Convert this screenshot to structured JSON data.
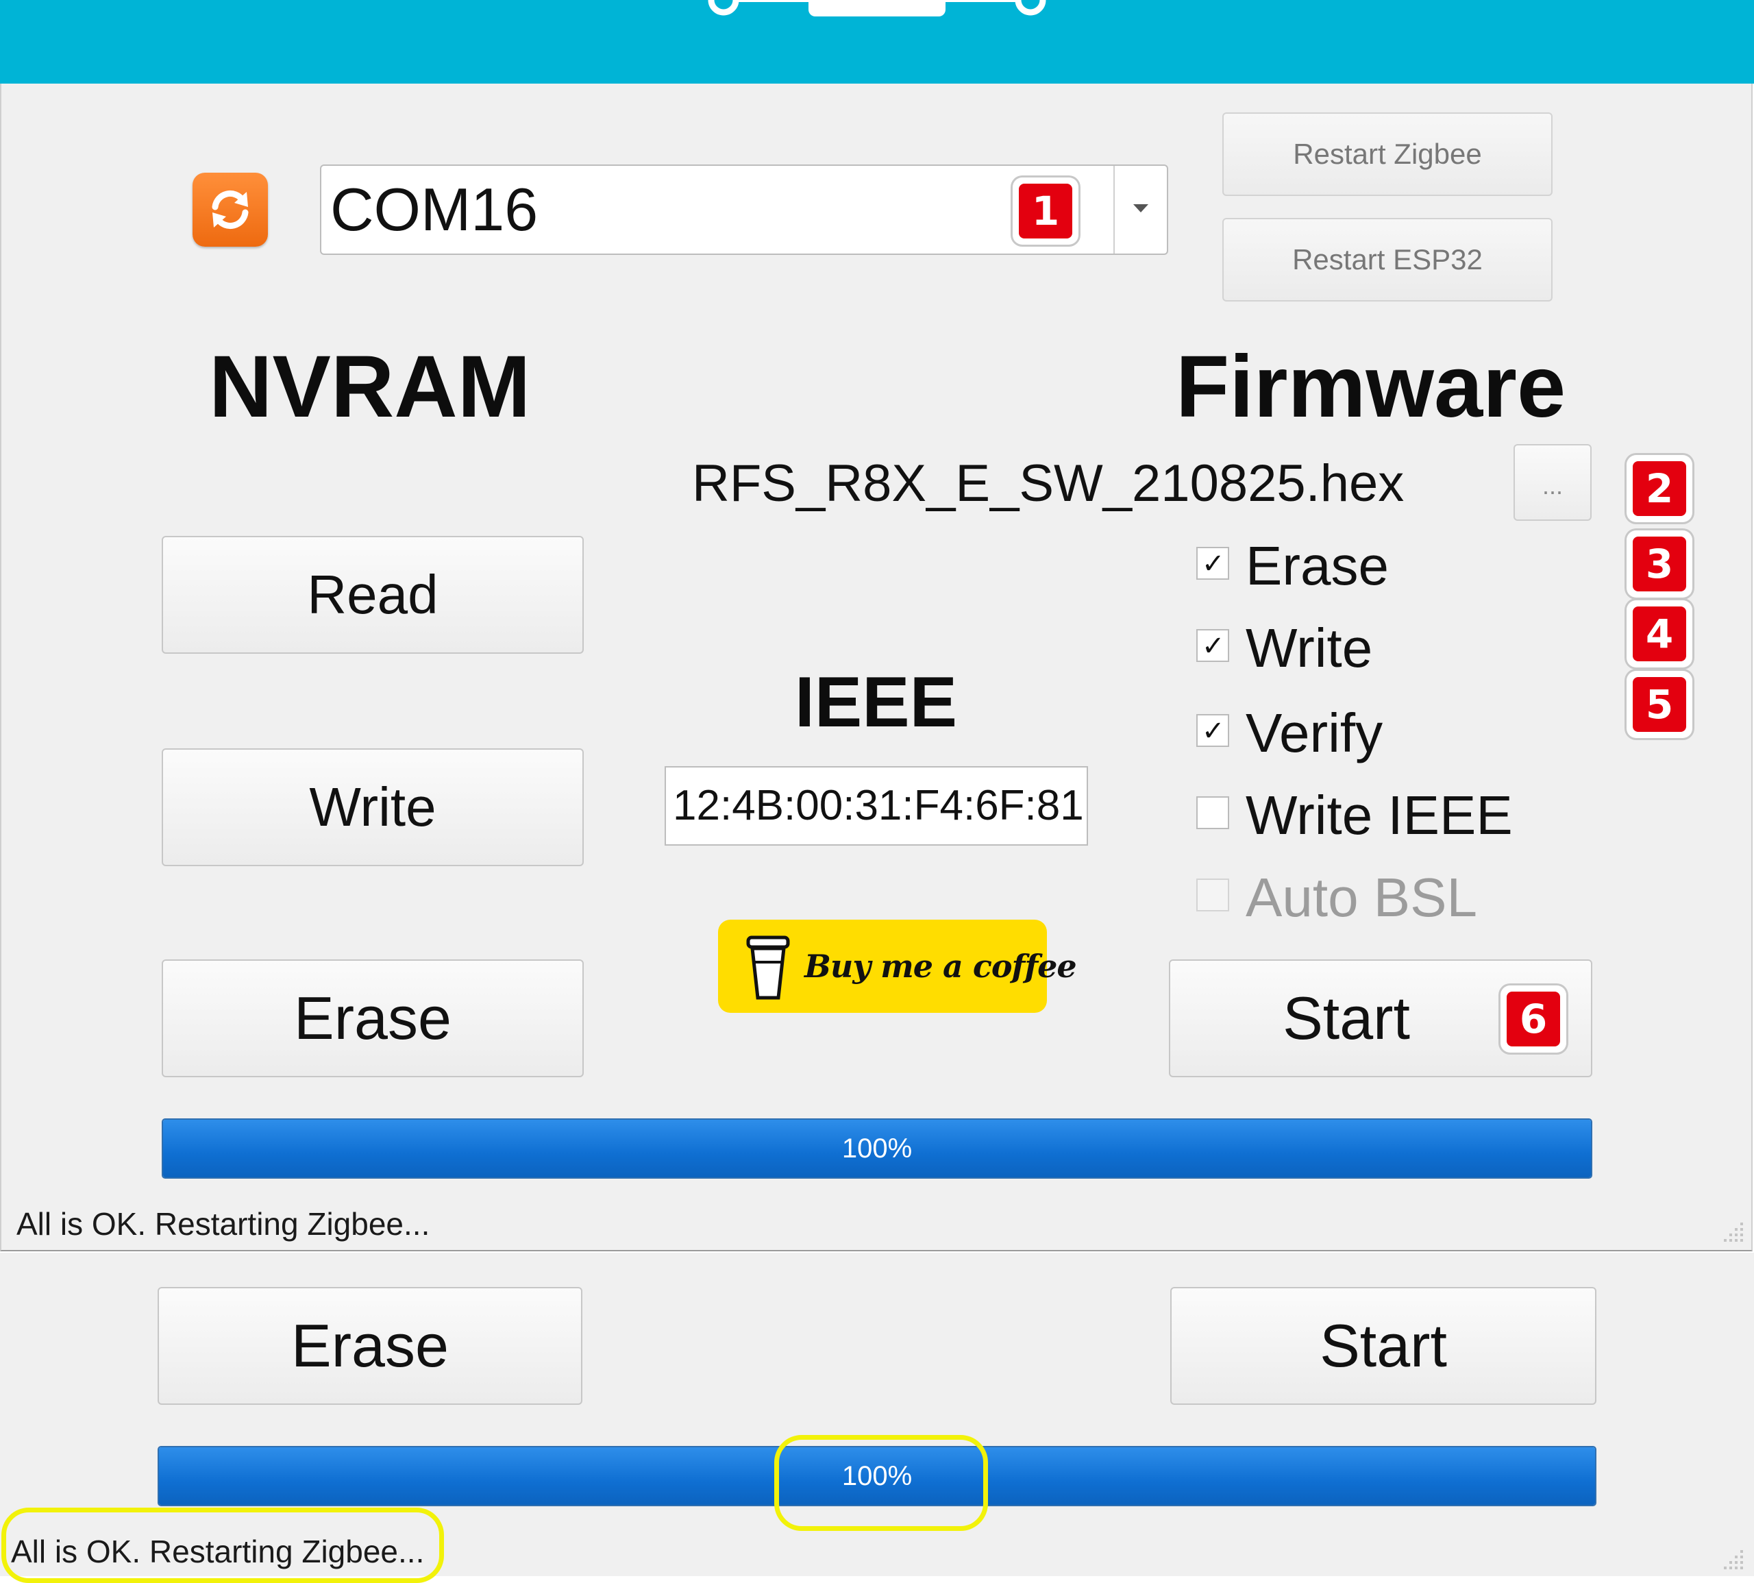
{
  "port": {
    "value": "COM16"
  },
  "actions": {
    "restart_zigbee": "Restart Zigbee",
    "restart_esp32": "Restart ESP32"
  },
  "nvram": {
    "title": "NVRAM",
    "read": "Read",
    "write": "Write",
    "erase": "Erase"
  },
  "firmware": {
    "title": "Firmware",
    "file": "RFS_R8X_E_SW_210825.hex",
    "browse": "...",
    "options": [
      {
        "label": "Erase",
        "checked": true,
        "enabled": true
      },
      {
        "label": "Write",
        "checked": true,
        "enabled": true
      },
      {
        "label": "Verify",
        "checked": true,
        "enabled": true
      },
      {
        "label": "Write IEEE",
        "checked": false,
        "enabled": true
      },
      {
        "label": "Auto BSL",
        "checked": false,
        "enabled": false
      }
    ],
    "start": "Start"
  },
  "ieee": {
    "title": "IEEE",
    "value": "12:4B:00:31:F4:6F:81"
  },
  "coffee": {
    "label": "Buy me a coffee"
  },
  "progress": {
    "value": 1.0,
    "text": "100%"
  },
  "status": {
    "text": "All is OK. Restarting Zigbee..."
  },
  "markers": [
    "1",
    "2",
    "3",
    "4",
    "5",
    "6"
  ],
  "zoom": {
    "erase": "Erase",
    "start": "Start",
    "progress_value": 1.0,
    "progress_text": "100%",
    "status": "All is OK. Restarting Zigbee..."
  },
  "colors": {
    "header": "#00b4d6",
    "refresh": "#f07318",
    "marker": "#e3000f",
    "progress": "#1077d8",
    "coffee": "#ffdd00",
    "highlight": "#f2f20a"
  },
  "icons": {
    "refresh": "refresh-icon",
    "dropdown": "chevron-down-icon",
    "coffee": "coffee-cup-icon",
    "logo": "circuit-logo-icon"
  }
}
